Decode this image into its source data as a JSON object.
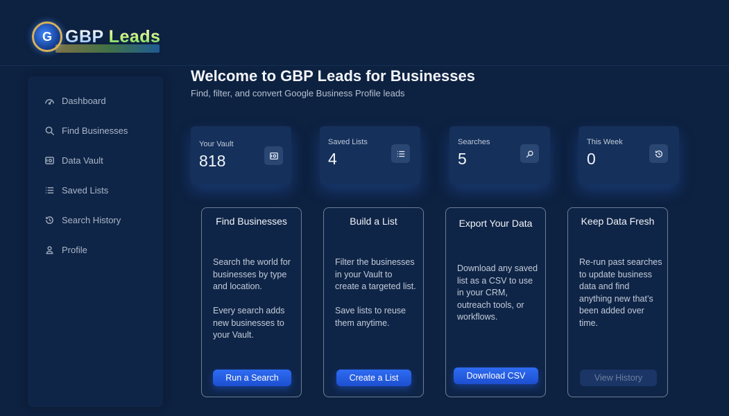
{
  "app": {
    "logo_main": "GBP",
    "logo_accent": "Leads",
    "logo_badge": "G"
  },
  "sidebar": {
    "items": [
      {
        "label": "Dashboard",
        "icon": "dashboard-gauge-icon"
      },
      {
        "label": "Find Businesses",
        "icon": "search-icon"
      },
      {
        "label": "Data Vault",
        "icon": "vault-icon"
      },
      {
        "label": "Saved Lists",
        "icon": "list-icon"
      },
      {
        "label": "Search History",
        "icon": "history-icon"
      },
      {
        "label": "Profile",
        "icon": "user-icon"
      }
    ]
  },
  "header": {
    "title": "Welcome to GBP Leads for Businesses",
    "subtitle": "Find, filter, and convert Google Business Profile leads"
  },
  "stats": [
    {
      "label": "Your Vault",
      "value": "818",
      "icon": "vault-icon"
    },
    {
      "label": "Saved Lists",
      "value": "4",
      "icon": "list-icon"
    },
    {
      "label": "Searches",
      "value": "5",
      "icon": "search-icon"
    },
    {
      "label": "This Week",
      "value": "0",
      "icon": "history-icon"
    }
  ],
  "cards": [
    {
      "title": "Find Businesses",
      "body": "Search the world for businesses by type and location.\n\nEvery search adds new businesses to your Vault.",
      "button": "Run a Search"
    },
    {
      "title": "Build a List",
      "body": "Filter the businesses in your Vault to create a targeted list.\n\nSave lists to reuse them anytime.",
      "button": "Create a List"
    },
    {
      "title": "Export Your Data",
      "body": "Download any saved list as a CSV to use in your CRM, outreach tools, or workflows.",
      "button": "Download CSV"
    },
    {
      "title": "Keep Data Fresh",
      "body": "Re-run past searches to update business data and find anything new that’s been added over time.",
      "button": "View History"
    }
  ],
  "colors": {
    "background": "#0d2140",
    "accent": "#2e6cf2",
    "card_border": "#6d7d96"
  }
}
